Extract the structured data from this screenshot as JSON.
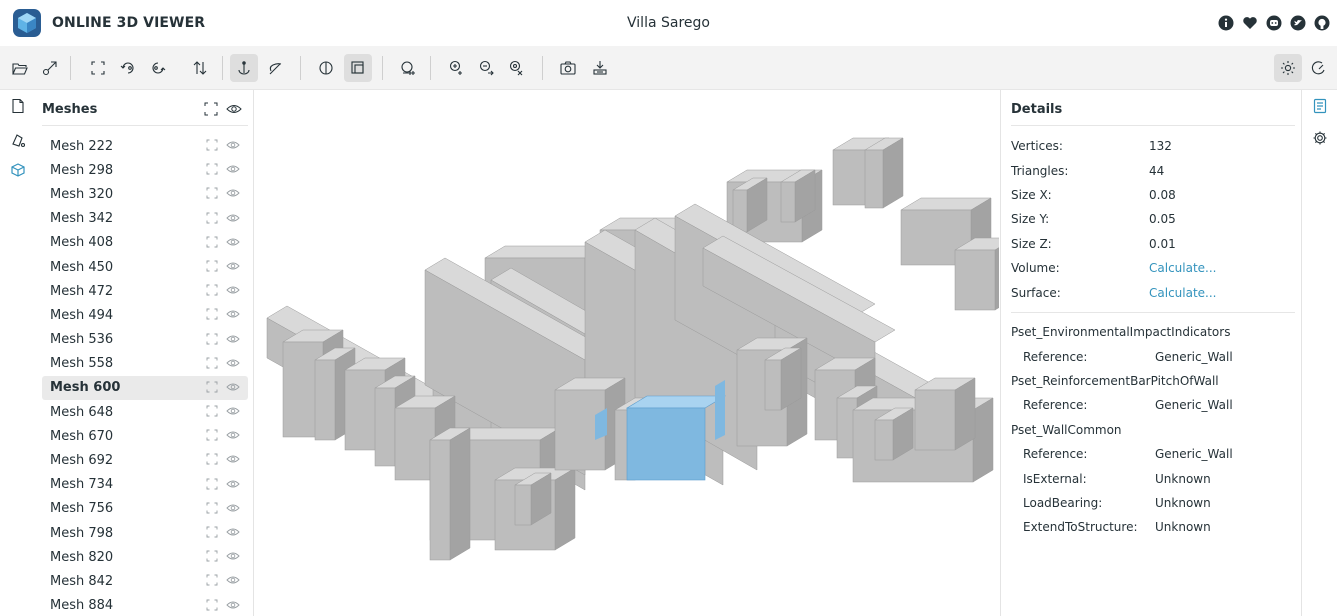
{
  "header": {
    "app_title": "ONLINE 3D VIEWER",
    "model_title": "Villa Sarego",
    "links": [
      "info-icon",
      "heart-icon",
      "discord-icon",
      "twitter-icon",
      "github-icon"
    ]
  },
  "toolbar": {
    "left_tools": [
      "open-file-icon",
      "open-url-icon",
      "fit-to-window-icon",
      "set-up-vector-icon",
      "flip-up-vector-icon",
      "fix-up-vector-icon",
      "fix-up-vector-icon",
      "free-orbit-icon",
      "perspective-camera-icon",
      "orthographic-camera-icon",
      "measure-tool-icon",
      "export-model-icon",
      "share-model-icon",
      "export-snapshot-icon",
      "snapshot-icon",
      "embed-icon"
    ],
    "right_tools": [
      "light-theme-icon",
      "dark-theme-icon"
    ]
  },
  "left_nav": [
    "file-details-icon",
    "materials-icon",
    "meshes-icon"
  ],
  "meshes_panel": {
    "title": "Meshes",
    "selected": "Mesh 600",
    "items": [
      "Mesh 222",
      "Mesh 298",
      "Mesh 320",
      "Mesh 342",
      "Mesh 408",
      "Mesh 450",
      "Mesh 472",
      "Mesh 494",
      "Mesh 536",
      "Mesh 558",
      "Mesh 600",
      "Mesh 648",
      "Mesh 670",
      "Mesh 692",
      "Mesh 734",
      "Mesh 756",
      "Mesh 798",
      "Mesh 820",
      "Mesh 842",
      "Mesh 884"
    ]
  },
  "details_panel": {
    "title": "Details",
    "properties": [
      {
        "key": "Vertices:",
        "value": "132",
        "link": false
      },
      {
        "key": "Triangles:",
        "value": "44",
        "link": false
      },
      {
        "key": "Size X:",
        "value": "0.08",
        "link": false
      },
      {
        "key": "Size Y:",
        "value": "0.05",
        "link": false
      },
      {
        "key": "Size Z:",
        "value": "0.01",
        "link": false
      },
      {
        "key": "Volume:",
        "value": "Calculate...",
        "link": true
      },
      {
        "key": "Surface:",
        "value": "Calculate...",
        "link": true
      }
    ],
    "psets": [
      {
        "name": "Pset_EnvironmentalImpactIndicators",
        "rows": [
          {
            "key": "Reference:",
            "value": "Generic_Wall"
          }
        ]
      },
      {
        "name": "Pset_ReinforcementBarPitchOfWall",
        "rows": [
          {
            "key": "Reference:",
            "value": "Generic_Wall"
          }
        ]
      },
      {
        "name": "Pset_WallCommon",
        "rows": [
          {
            "key": "Reference:",
            "value": "Generic_Wall"
          },
          {
            "key": "IsExternal:",
            "value": "Unknown"
          },
          {
            "key": "LoadBearing:",
            "value": "Unknown"
          },
          {
            "key": "ExtendToStructure:",
            "value": "Unknown"
          }
        ]
      }
    ]
  },
  "right_nav": [
    "details-icon",
    "settings-icon"
  ],
  "colors": {
    "accent": "#3393bd",
    "selected_mesh": "#7fb8e0",
    "model_light": "#d9d9d9",
    "model_mid": "#bdbdbd",
    "model_dark": "#a3a3a3"
  }
}
